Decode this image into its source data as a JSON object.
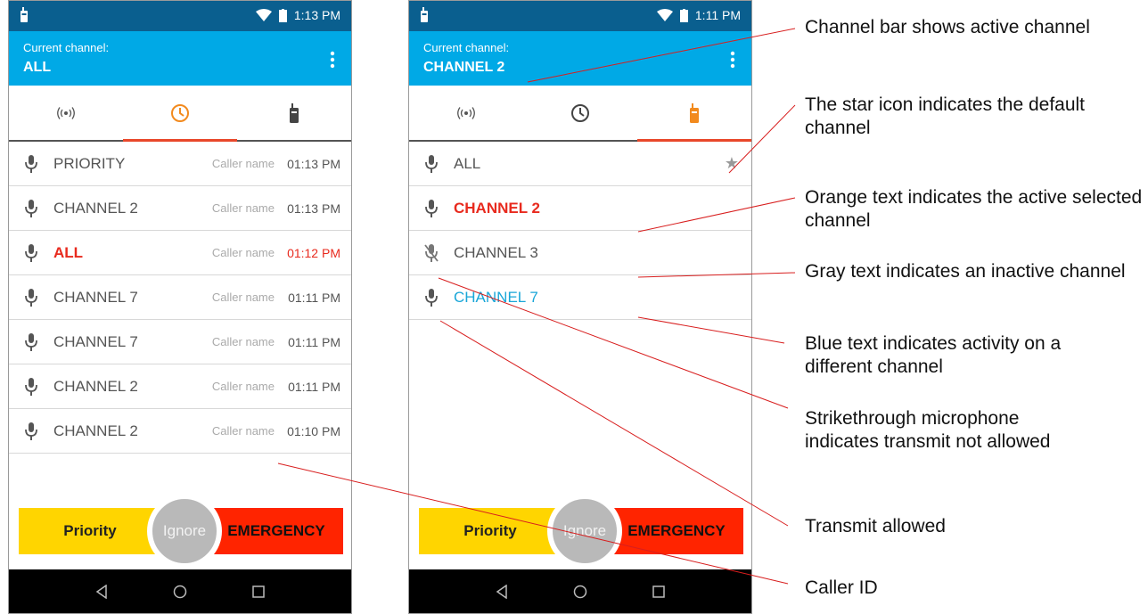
{
  "left_screen": {
    "status_time": "1:13 PM",
    "channel_bar": {
      "label": "Current channel:",
      "value": "ALL"
    },
    "active_tab": "history",
    "rows": [
      {
        "name": "PRIORITY",
        "caller": "Caller name",
        "time": "01:13 PM"
      },
      {
        "name": "CHANNEL 2",
        "caller": "Caller name",
        "time": "01:13 PM"
      },
      {
        "name": "ALL",
        "caller": "Caller name",
        "time": "01:12 PM",
        "active": true
      },
      {
        "name": "CHANNEL 7",
        "caller": "Caller name",
        "time": "01:11 PM"
      },
      {
        "name": "CHANNEL 7",
        "caller": "Caller name",
        "time": "01:11 PM"
      },
      {
        "name": "CHANNEL 2",
        "caller": "Caller name",
        "time": "01:11 PM"
      },
      {
        "name": "CHANNEL 2",
        "caller": "Caller name",
        "time": "01:10 PM"
      }
    ],
    "buttons": {
      "priority": "Priority",
      "ignore": "Ignore",
      "emergency": "EMERGENCY"
    }
  },
  "right_screen": {
    "status_time": "1:11 PM",
    "channel_bar": {
      "label": "Current channel:",
      "value": "CHANNEL 2"
    },
    "active_tab": "channels",
    "rows": [
      {
        "name": "ALL",
        "state": "normal",
        "default_star": true
      },
      {
        "name": "CHANNEL 2",
        "state": "active"
      },
      {
        "name": "CHANNEL 3",
        "state": "inactive",
        "transmit_allowed": false
      },
      {
        "name": "CHANNEL 7",
        "state": "activity"
      }
    ],
    "buttons": {
      "priority": "Priority",
      "ignore": "Ignore",
      "emergency": "EMERGENCY"
    }
  },
  "annotations": {
    "channel_bar": "Channel bar shows active channel",
    "star": "The star icon indicates the default channel",
    "orange": "Orange text indicates the active selected channel",
    "gray": "Gray text indicates an inactive channel",
    "blue": "Blue text indicates activity on a different channel",
    "strike": "Strikethrough microphone indicates transmit not allowed",
    "transmit": "Transmit allowed",
    "caller_id": "Caller ID"
  },
  "colors": {
    "status_bar": "#0a5f8f",
    "channel_bar": "#00a9e6",
    "active_red": "#e82a1e",
    "activity_blue": "#19a6d8",
    "priority_yellow": "#ffd500",
    "emergency_red": "#ff2400",
    "leader_line": "#d81e1e"
  },
  "icons": [
    "radio-waves-icon",
    "clock-icon",
    "walkie-talkie-icon",
    "microphone-icon",
    "microphone-muted-icon",
    "star-icon",
    "more-vert-icon",
    "wifi-icon",
    "battery-icon",
    "back-icon",
    "home-icon",
    "recents-icon"
  ]
}
